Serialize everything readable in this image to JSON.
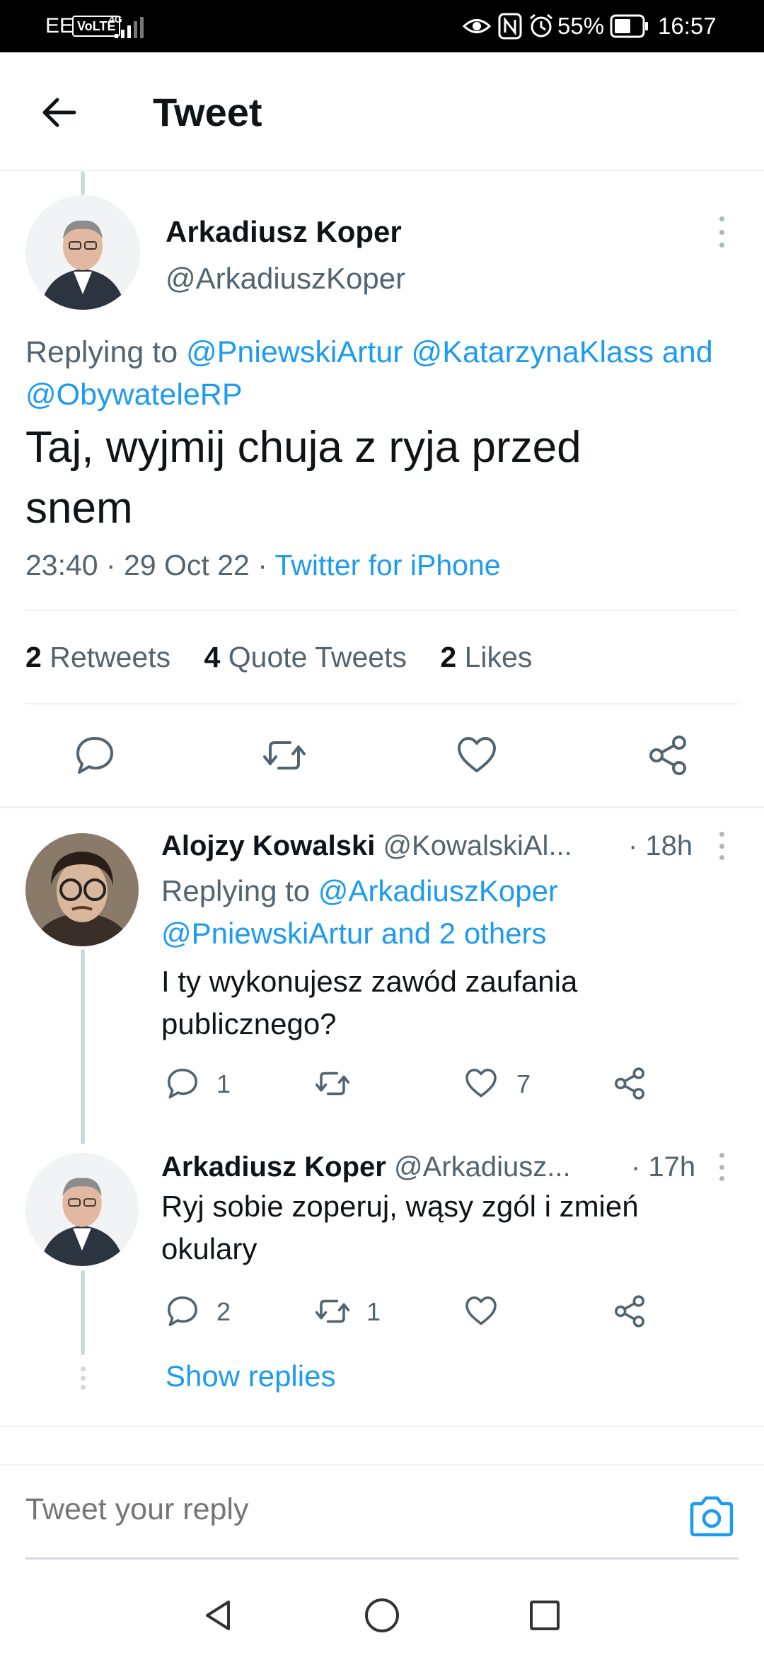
{
  "status_bar": {
    "carrier": "EE",
    "volte": "VoLTE",
    "network": "4G",
    "battery": "55%",
    "time": "16:57"
  },
  "header": {
    "title": "Tweet",
    "back_icon": "arrow-left-icon"
  },
  "main_tweet": {
    "author_name": "Arkadiusz Koper",
    "author_handle": "@ArkadiuszKoper",
    "replying_prefix": "Replying to",
    "replying_line1_mentions": "@PniewskiArtur @KatarzynaKlass and",
    "replying_line2_mentions": "@ObywateleRP",
    "text_line1": "Taj, wyjmij chuja z ryja przed",
    "text_line2": "snem",
    "timestamp": "23:40 · 29 Oct 22 ·",
    "source": "Twitter for iPhone",
    "stats": {
      "retweets_count": "2",
      "retweets_label": "Retweets",
      "quotes_count": "4",
      "quotes_label": "Quote Tweets",
      "likes_count": "2",
      "likes_label": "Likes"
    }
  },
  "replies": [
    {
      "author_name": "Alojzy Kowalski",
      "author_handle": "@KowalskiAl...",
      "time": "· 18h",
      "replying_prefix": "Replying to",
      "replying_line1_mention": "@ArkadiuszKoper",
      "replying_line2": "@PniewskiArtur and 2 others",
      "text_line1": "I ty wykonujesz zawód zaufania",
      "text_line2": "publicznego?",
      "reply_count": "1",
      "retweet_count": "",
      "like_count": "7"
    },
    {
      "author_name": "Arkadiusz Koper",
      "author_handle": "@Arkadiusz...",
      "time": "· 17h",
      "text_line1": "Ryj sobie zoperuj, wąsy zgól i zmień",
      "text_line2": "okulary",
      "reply_count": "2",
      "retweet_count": "1",
      "like_count": "",
      "show_replies": "Show replies"
    }
  ],
  "compose": {
    "placeholder": "Tweet your reply",
    "camera_icon": "camera-icon"
  },
  "colors": {
    "accent": "#1d9bf0",
    "text_primary": "#0f1419",
    "text_secondary": "#536471",
    "divider": "#eff3f4"
  }
}
